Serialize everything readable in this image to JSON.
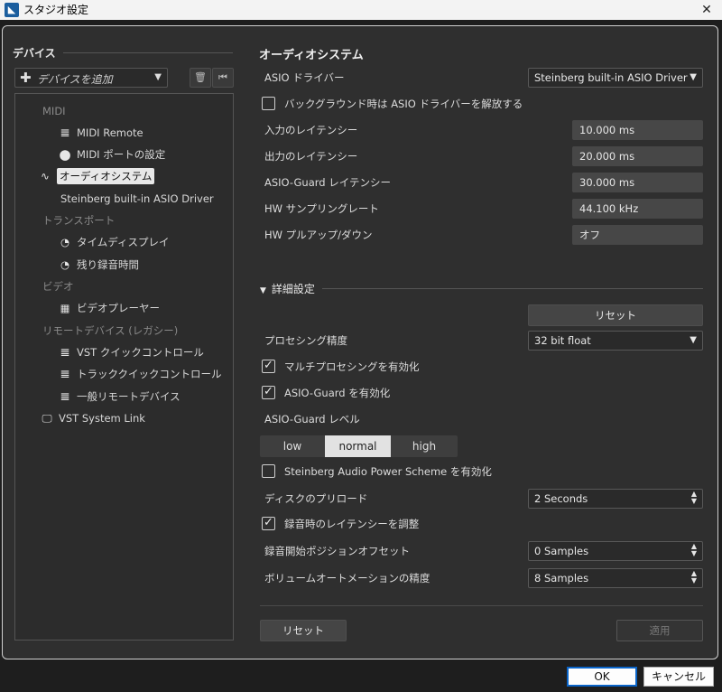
{
  "window": {
    "title": "スタジオ設定",
    "close_glyph": "✕",
    "app_icon": "cubase-logo"
  },
  "sidebar": {
    "header": "デバイス",
    "add_device": {
      "plus": "✚",
      "label": "デバイスを追加",
      "caret": "▼"
    },
    "delete_icon": "🗑",
    "reset_icon": "⏮",
    "items": [
      {
        "label": "MIDI",
        "type": "category"
      },
      {
        "label": "MIDI Remote",
        "icon": "midi-keyboard-icon",
        "glyph": "𝌆"
      },
      {
        "label": "MIDI ポートの設定",
        "icon": "midi-port-icon",
        "glyph": "⬤"
      },
      {
        "label": "オーディオシステム",
        "icon": "audio-wave-icon",
        "glyph": "∿",
        "selected": true
      },
      {
        "label": "Steinberg built-in ASIO Driver"
      },
      {
        "label": "トランスポート",
        "type": "category"
      },
      {
        "label": "タイムディスプレイ",
        "icon": "clock-icon",
        "glyph": "◔"
      },
      {
        "label": "残り録音時間",
        "icon": "clock-icon",
        "glyph": "◔"
      },
      {
        "label": "ビデオ",
        "type": "category"
      },
      {
        "label": "ビデオプレーヤー",
        "icon": "film-icon",
        "glyph": "▦"
      },
      {
        "label": "リモートデバイス (レガシー)",
        "type": "category"
      },
      {
        "label": "VST クイックコントロール",
        "icon": "midi-keyboard-icon",
        "glyph": "𝌆"
      },
      {
        "label": "トラッククイックコントロール",
        "icon": "midi-keyboard-icon",
        "glyph": "𝌆"
      },
      {
        "label": "一般リモートデバイス",
        "icon": "midi-keyboard-icon",
        "glyph": "𝌆"
      },
      {
        "label": "VST System Link",
        "icon": "monitor-icon",
        "glyph": "🖵"
      }
    ]
  },
  "main": {
    "title": "オーディオシステム",
    "asio_driver": {
      "label": "ASIO ドライバー",
      "value": "Steinberg built-in ASIO Driver",
      "caret": "▼"
    },
    "release_driver": {
      "label": "バックグラウンド時は ASIO ドライバーを解放する",
      "checked": false
    },
    "input_latency": {
      "label": "入力のレイテンシー",
      "value": "10.000 ms"
    },
    "output_latency": {
      "label": "出力のレイテンシー",
      "value": "20.000 ms"
    },
    "asio_guard_latency": {
      "label": "ASIO-Guard レイテンシー",
      "value": "30.000 ms"
    },
    "sample_rate": {
      "label": "HW サンプリングレート",
      "value": "44.100 kHz"
    },
    "pull_up_down": {
      "label": "HW プルアップ/ダウン",
      "value": "オフ"
    },
    "advanced": {
      "header": "詳細設定",
      "toggle_glyph": "▼",
      "reset_label": "リセット",
      "precision": {
        "label": "プロセシング精度",
        "value": "32 bit float",
        "caret": "▼"
      },
      "multiprocessing": {
        "label": "マルチプロセシングを有効化",
        "checked": true
      },
      "asio_guard": {
        "label": "ASIO-Guard を有効化",
        "checked": true
      },
      "asio_guard_level": {
        "label": "ASIO-Guard レベル",
        "options": [
          "low",
          "normal",
          "high"
        ],
        "selected": "normal"
      },
      "power_scheme": {
        "label": "Steinberg Audio Power Scheme を有効化",
        "checked": false
      },
      "disk_preload": {
        "label": "ディスクのプリロード",
        "value": "2 Seconds"
      },
      "adjust_latency": {
        "label": "録音時のレイテンシーを調整",
        "checked": true
      },
      "record_offset": {
        "label": "録音開始ポジションオフセット",
        "value": "0 Samples"
      },
      "automation_precision": {
        "label": "ボリュームオートメーションの精度",
        "value": "8 Samples"
      }
    },
    "check_glyph": "✓",
    "spin_up": "▲",
    "spin_down": "▼",
    "reset_button": "リセット",
    "apply_button": "適用"
  },
  "footer": {
    "ok": "OK",
    "cancel": "キャンセル"
  },
  "colors": {
    "accent": "#0a64c8",
    "selected_bg": "#e8e8e8",
    "panel_bg": "#2f2f2f"
  }
}
